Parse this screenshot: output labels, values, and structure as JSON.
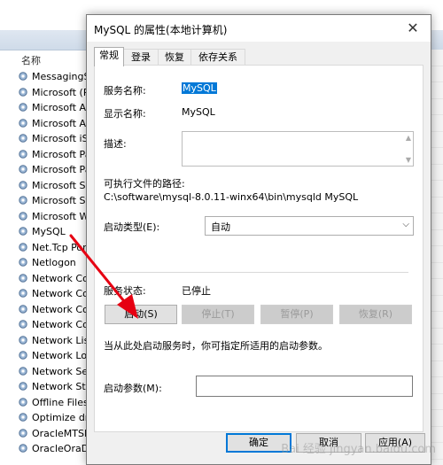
{
  "background": {
    "column_header": "名称",
    "services": [
      "MessagingS",
      "Microsoft (R",
      "Microsoft Ac",
      "Microsoft Ap",
      "Microsoft iS",
      "Microsoft Pa",
      "Microsoft Pa",
      "Microsoft Sc",
      "Microsoft St",
      "Microsoft W",
      "MySQL",
      "Net.Tcp Por",
      "Netlogon",
      "Network Co",
      "Network Co",
      "Network Co",
      "Network Co",
      "Network List",
      "Network Loc",
      "Network Set",
      "Network Sto",
      "Offline Files",
      "Optimize dri",
      "OracleMTSR",
      "OracleOraDl"
    ]
  },
  "dialog": {
    "title": "MySQL 的属性(本地计算机)",
    "close_glyph": "✕",
    "tabs": [
      "常规",
      "登录",
      "恢复",
      "依存关系"
    ],
    "service_name_label": "服务名称:",
    "service_name_value": "MySQL",
    "display_name_label": "显示名称:",
    "display_name_value": "MySQL",
    "description_label": "描述:",
    "exe_path_label": "可执行文件的路径:",
    "exe_path_value": "C:\\software\\mysql-8.0.11-winx64\\bin\\mysqld MySQL",
    "startup_type_label": "启动类型(E):",
    "startup_type_value": "自动",
    "service_status_label": "服务状态:",
    "service_status_value": "已停止",
    "buttons": {
      "start": "启动(S)",
      "stop": "停止(T)",
      "pause": "暂停(P)",
      "resume": "恢复(R)"
    },
    "hint": "当从此处启动服务时，你可指定所适用的启动参数。",
    "start_params_label": "启动参数(M):",
    "start_params_value": "",
    "ok": "确定",
    "cancel": "取消",
    "apply": "应用(A)"
  },
  "watermark": "Bai 经验 jingyan.baidu.com",
  "colors": {
    "accent": "#0078d7",
    "annotation_arrow": "#e60012"
  }
}
